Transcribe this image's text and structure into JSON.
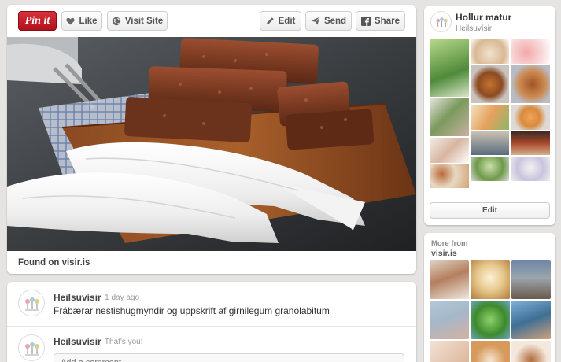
{
  "toolbar": {
    "pin_label": "Pin it",
    "like_label": "Like",
    "visit_label": "Visit Site",
    "edit_label": "Edit",
    "send_label": "Send",
    "share_label": "Share"
  },
  "pin": {
    "found_on": "Found on visir.is"
  },
  "comments": [
    {
      "author": "Heilsuvísir",
      "time": "· 1 day ago",
      "text": "Frábærar nestishugmyndir og uppskrift af girnilegum granólabitum"
    },
    {
      "author": "Heilsuvísir",
      "time": "· That's you!",
      "placeholder": "Add a comment..."
    }
  ],
  "board": {
    "name": "Hollur matur",
    "owner": "Heilsuvísir",
    "edit_label": "Edit"
  },
  "more": {
    "label": "More from",
    "source": "visir.is"
  },
  "icons": {
    "like": "heart-icon",
    "visit": "globe-icon",
    "edit": "pencil-icon",
    "send": "paper-plane-icon",
    "share": "facebook-icon"
  },
  "colors": {
    "pin_button": "#cb2027",
    "page_background": "#e6e3e3"
  }
}
